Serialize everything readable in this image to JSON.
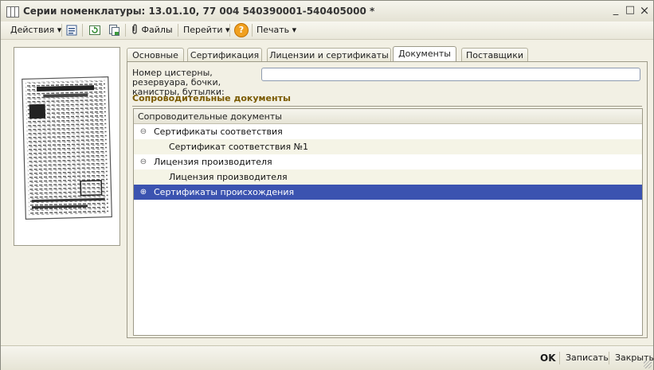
{
  "window": {
    "title": "Серии номенклатуры: 13.01.10, 77 004 540390001-540405000 *",
    "controls": {
      "minimize": "_",
      "maximize": "□",
      "close": "×"
    }
  },
  "toolbar": {
    "actions_label": "Действия",
    "files_label": "Файлы",
    "goto_label": "Перейти",
    "help_label": "?",
    "print_label": "Печать",
    "dropdown_glyph": "▾"
  },
  "tabs": [
    {
      "label": "Основные"
    },
    {
      "label": "Сертификация"
    },
    {
      "label": "Лицензии и сертификаты"
    },
    {
      "label": "Документы"
    },
    {
      "label": "Поставщики"
    }
  ],
  "documents_tab": {
    "container_label": "Номер цистерны, резервуара, бочки, канистры, бутылки:",
    "container_value": "",
    "section_title": "Сопроводительные документы",
    "tree": {
      "header": "Сопроводительные документы",
      "rows": [
        {
          "label": "Сертификаты соответствия",
          "toggle": "⊖"
        },
        {
          "label": "Сертификат соответствия №1",
          "toggle": ""
        },
        {
          "label": "Лицензия производителя",
          "toggle": "⊖"
        },
        {
          "label": "Лицензия производителя",
          "toggle": ""
        },
        {
          "label": "Сертификаты происхождения",
          "toggle": "⊕"
        }
      ]
    }
  },
  "footer": {
    "ok_label": "OK",
    "save_label": "Записать",
    "close_label": "Закрыть"
  },
  "colors": {
    "selection": "#3b53b0",
    "section_title": "#7a5a00",
    "window_bg": "#f2f0e4"
  },
  "icons": [
    "window-icon",
    "list-icon",
    "refresh-icon",
    "copy-icon",
    "paperclip-icon",
    "help-icon",
    "scanned-document-icon"
  ]
}
